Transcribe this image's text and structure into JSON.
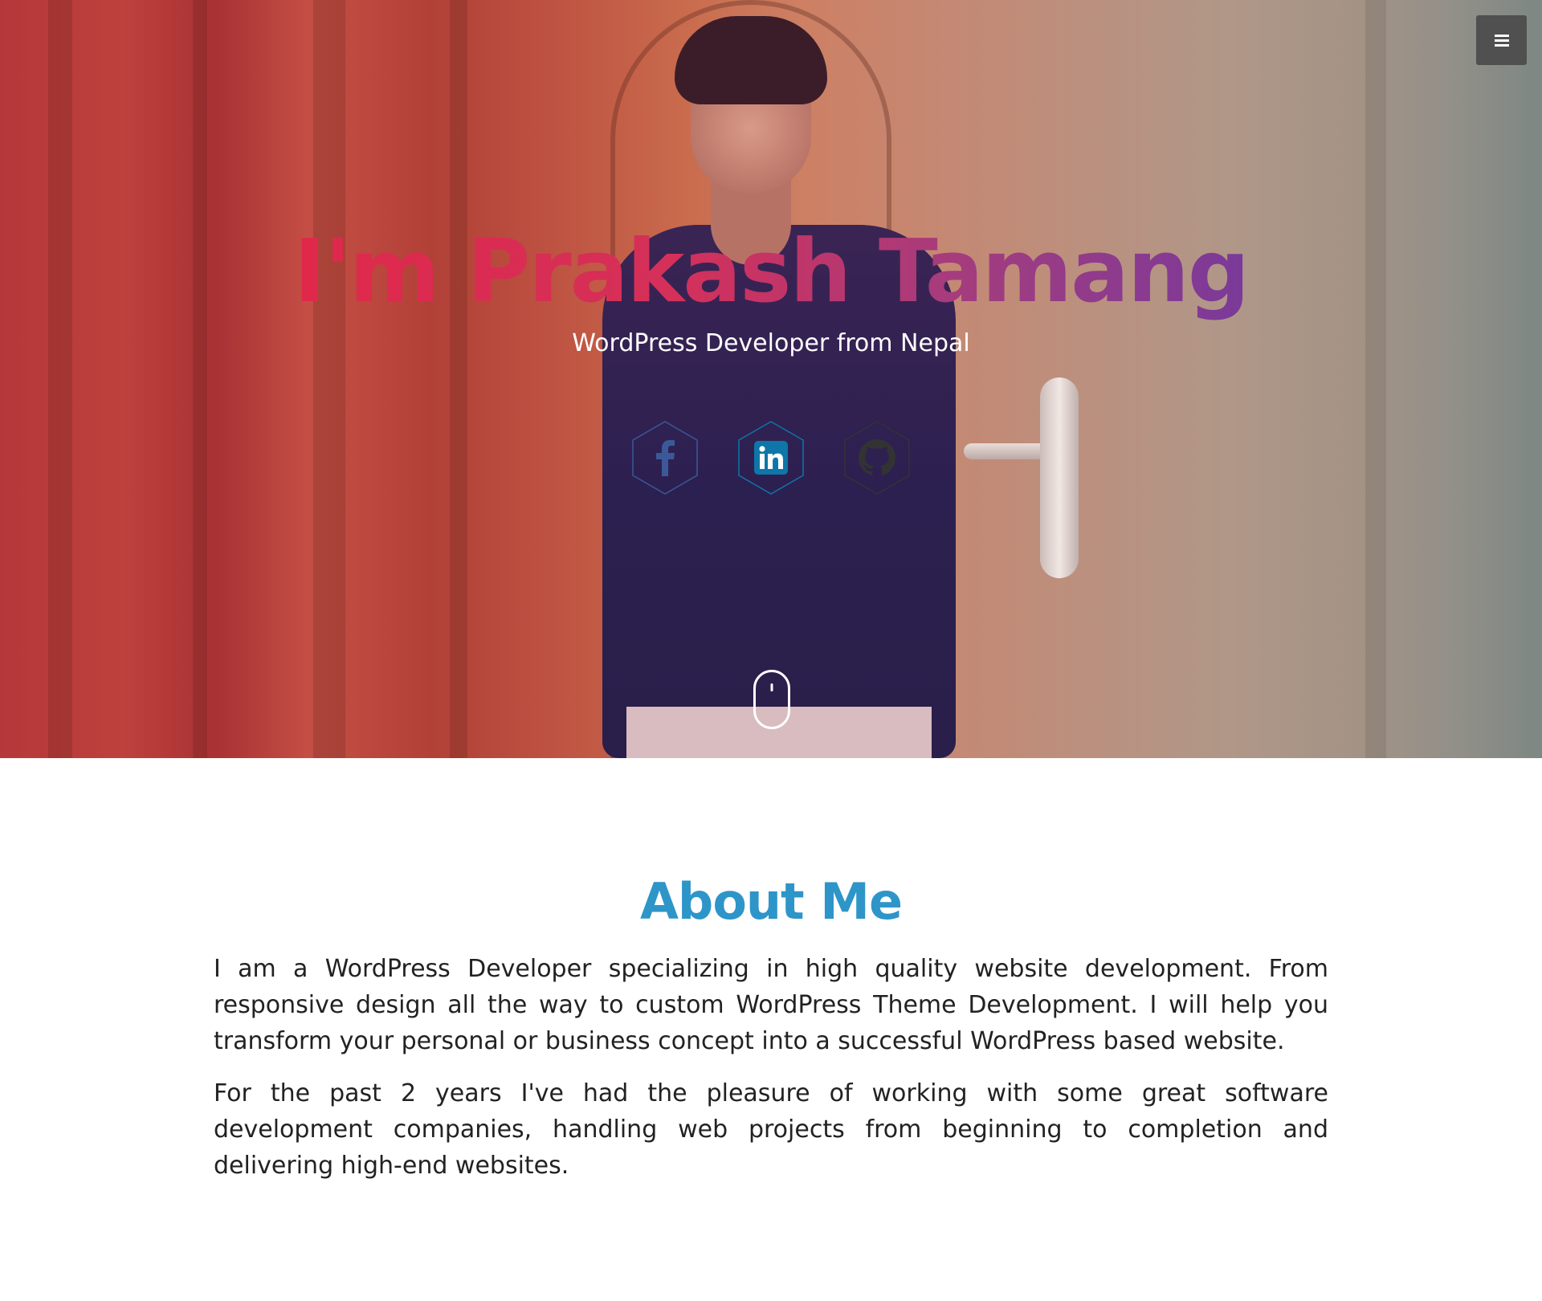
{
  "hero": {
    "title": "I'm Prakash Tamang",
    "subtitle": "WordPress Developer from Nepal",
    "social": [
      {
        "name": "facebook",
        "icon": "facebook-icon",
        "color": "#3b5998"
      },
      {
        "name": "linkedin",
        "icon": "linkedin-icon",
        "color": "#0e76a8"
      },
      {
        "name": "github",
        "icon": "github-icon",
        "color": "#333333"
      }
    ],
    "title_gradient": [
      "#e0284a",
      "#7a3a9a"
    ]
  },
  "nav": {
    "menu_icon": "hamburger-icon"
  },
  "about": {
    "title": "About Me",
    "paragraphs": [
      "I am a WordPress Developer specializing in high quality website development. From responsive design all the way to custom WordPress Theme Development. I will help you transform your personal or business concept into a successful WordPress based website.",
      "For the past 2 years I've had the pleasure of working with some great software development companies, handling web projects from beginning to completion and delivering high-end websites."
    ],
    "title_color": "#2e95c9",
    "highlight_color": "#fcd7d9"
  }
}
